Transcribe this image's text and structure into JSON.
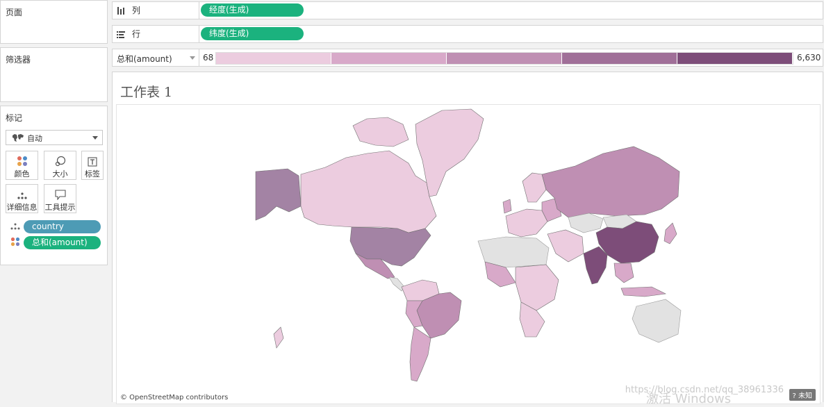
{
  "panels": {
    "pages_title": "页面",
    "filters_title": "筛选器",
    "marks_title": "标记"
  },
  "shelves": {
    "columns": {
      "label": "列",
      "pill": "经度(生成)"
    },
    "rows": {
      "label": "行",
      "pill": "纬度(生成)"
    },
    "color_legend": {
      "label": "总和(amount)",
      "min": "68",
      "max": "6,630"
    }
  },
  "marks": {
    "type_select": "自动",
    "buttons": {
      "color": "颜色",
      "size": "大小",
      "label": "标签",
      "detail": "详细信息",
      "tooltip": "工具提示"
    },
    "fields": [
      {
        "name": "country",
        "role": "detail"
      },
      {
        "name": "总和(amount)",
        "role": "color"
      }
    ]
  },
  "sheet": {
    "title": "工作表 1",
    "credit": "© OpenStreetMap contributors",
    "zoom_label": "? 未知"
  },
  "overlay": {
    "watermark_url": "https://blog.csdn.net/qq_38961336",
    "activate_text": "激活 Windows"
  },
  "colors": {
    "legend_steps": [
      "#ecccdf",
      "#d8a9c9",
      "#bf8fb3",
      "#a06f98",
      "#7d4d79"
    ],
    "no_data": "#e2e2e2",
    "pill_green": "#1bb27e",
    "pill_blue": "#4d9bb5"
  }
}
